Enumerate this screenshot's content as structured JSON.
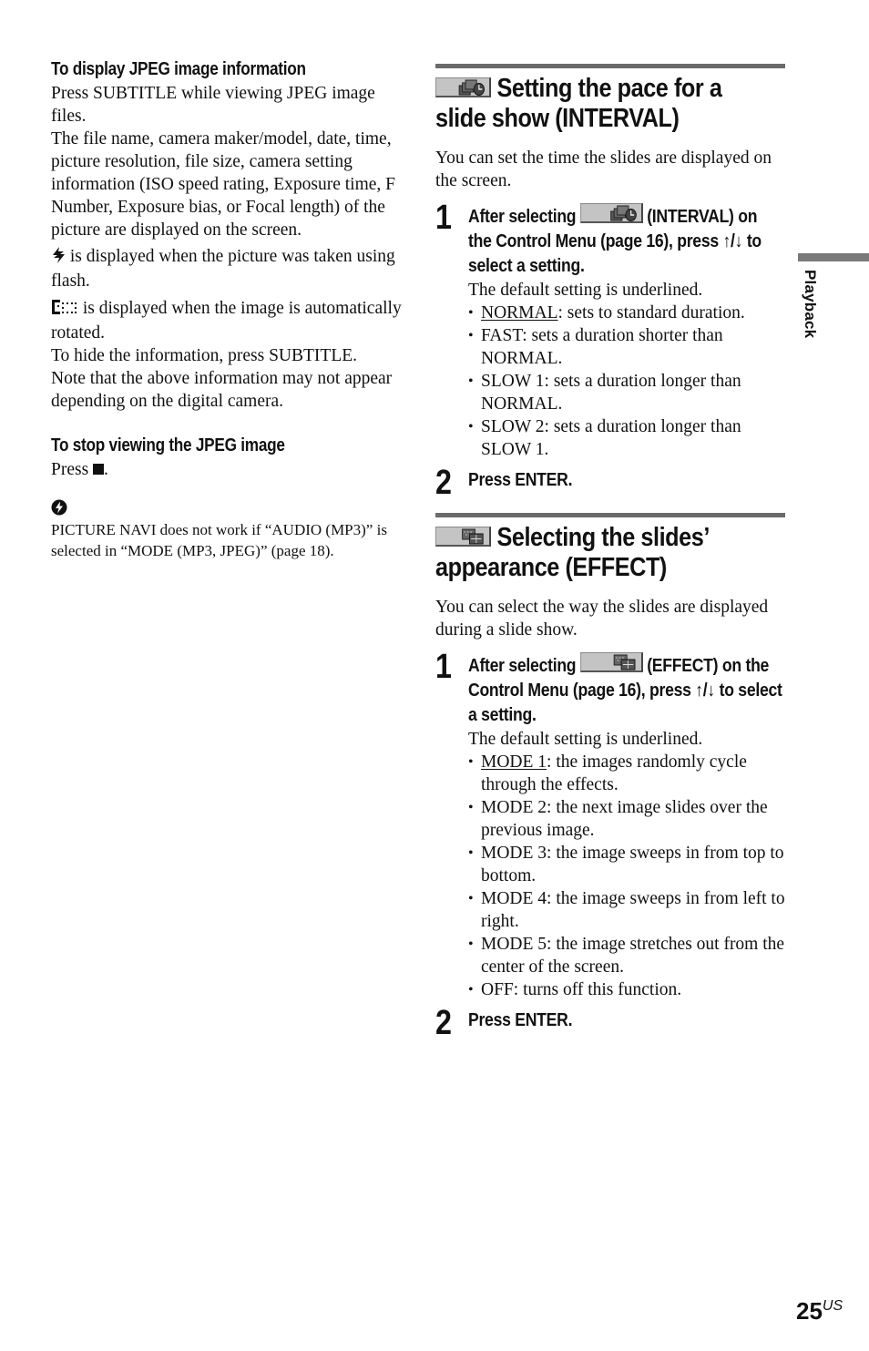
{
  "left_column": {
    "jpeg_info": {
      "heading": "To display JPEG image information",
      "p1": "Press SUBTITLE while viewing JPEG image files.",
      "p2": "The file name, camera maker/model, date, time, picture resolution, file size, camera setting information (ISO speed rating, Exposure time, F Number, Exposure bias, or Focal length) of the picture are displayed on the screen.",
      "flash_icon": "flash-icon",
      "flash_text": " is displayed when the picture was taken using flash.",
      "rotate_icon": "auto-rotate-icon",
      "rotate_text": " is displayed when the image is automatically rotated.",
      "p3": "To hide the information, press SUBTITLE.",
      "p4": "Note that the above information may not appear depending on the digital camera."
    },
    "stop_viewing": {
      "heading": "To stop viewing the JPEG image",
      "text_before": "Press ",
      "stop_icon": "stop-button-icon",
      "text_after": "."
    },
    "tip": {
      "icon": "tip-icon",
      "text": "PICTURE NAVI does not work if “AUDIO (MP3)” is selected in “MODE (MP3, JPEG)” (page 18)."
    }
  },
  "interval_section": {
    "icon": "interval-menu-icon",
    "title_line1": "Setting the pace for a",
    "title_line2": "slide show (INTERVAL)",
    "intro": "You can set the time the slides are displayed on the screen.",
    "steps": [
      {
        "number": "1",
        "text_before_icon": "After selecting ",
        "text_after_icon": " (INTERVAL) on the Control Menu (page 16), press ↑/↓ to select a setting.",
        "default_note": "The default setting is underlined.",
        "options": [
          {
            "name": "NORMAL",
            "default": true,
            "desc": ": sets to standard duration."
          },
          {
            "name": "FAST",
            "default": false,
            "desc": ": sets a duration shorter than NORMAL."
          },
          {
            "name": "SLOW 1",
            "default": false,
            "desc": ": sets a duration longer than NORMAL."
          },
          {
            "name": "SLOW 2",
            "default": false,
            "desc": ": sets a duration longer than SLOW 1."
          }
        ]
      },
      {
        "number": "2",
        "text": "Press ENTER."
      }
    ]
  },
  "effect_section": {
    "icon": "effect-menu-icon",
    "title_line1": "Selecting the slides’",
    "title_line2": "appearance (EFFECT)",
    "intro": "You can select the way the slides are displayed during a slide show.",
    "steps": [
      {
        "number": "1",
        "text_before_icon": "After selecting ",
        "text_after_icon": " (EFFECT) on the Control Menu (page 16), press ↑/↓ to select a setting.",
        "default_note": "The default setting is underlined.",
        "options": [
          {
            "name": "MODE 1",
            "default": true,
            "desc": ": the images randomly cycle through the effects."
          },
          {
            "name": "MODE 2",
            "default": false,
            "desc": ": the next image slides over the previous image."
          },
          {
            "name": "MODE 3",
            "default": false,
            "desc": ": the image sweeps in from top to bottom."
          },
          {
            "name": "MODE 4",
            "default": false,
            "desc": ": the image sweeps in from left to right."
          },
          {
            "name": "MODE 5",
            "default": false,
            "desc": ": the image stretches out from the center of the screen."
          },
          {
            "name": "OFF",
            "default": false,
            "desc": ": turns off this function."
          }
        ]
      },
      {
        "number": "2",
        "text": "Press ENTER."
      }
    ]
  },
  "side_tab": {
    "label": "Playback"
  },
  "footer": {
    "page_number": "25",
    "region_suffix": "US"
  }
}
